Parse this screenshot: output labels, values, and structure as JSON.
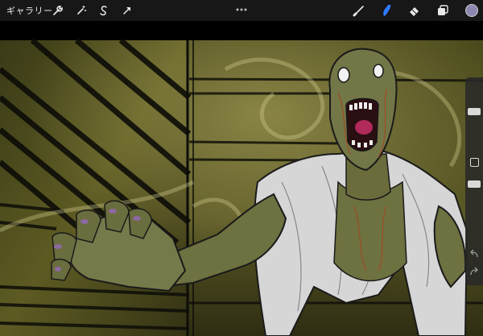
{
  "toolbar": {
    "gallery_label": "ギャラリー",
    "left_tools": [
      "wrench-icon",
      "magic-wand-icon",
      "selection-s-icon",
      "transform-arrow-icon"
    ],
    "right_tools": [
      "brush-icon",
      "smudge-icon",
      "eraser-icon",
      "layers-icon",
      "color-swatch"
    ],
    "active_tool": "smudge-icon",
    "colors": {
      "bar": "#171717",
      "icon": "#e9e9e9",
      "active": "#2f7bff",
      "swatch": "#8c88b2"
    }
  },
  "canvas": {
    "description_icon": "zombie-artwork",
    "colors": {
      "background": "#4e4d1a",
      "skin": "#6e7140",
      "robe": "#d6d6d6",
      "mouth": "#b02a5a"
    }
  },
  "sidebar": {
    "brush_size_level": 0.82,
    "opacity_level": 0.62,
    "icons": [
      "modify-square-icon",
      "undo-icon",
      "redo-icon"
    ]
  }
}
